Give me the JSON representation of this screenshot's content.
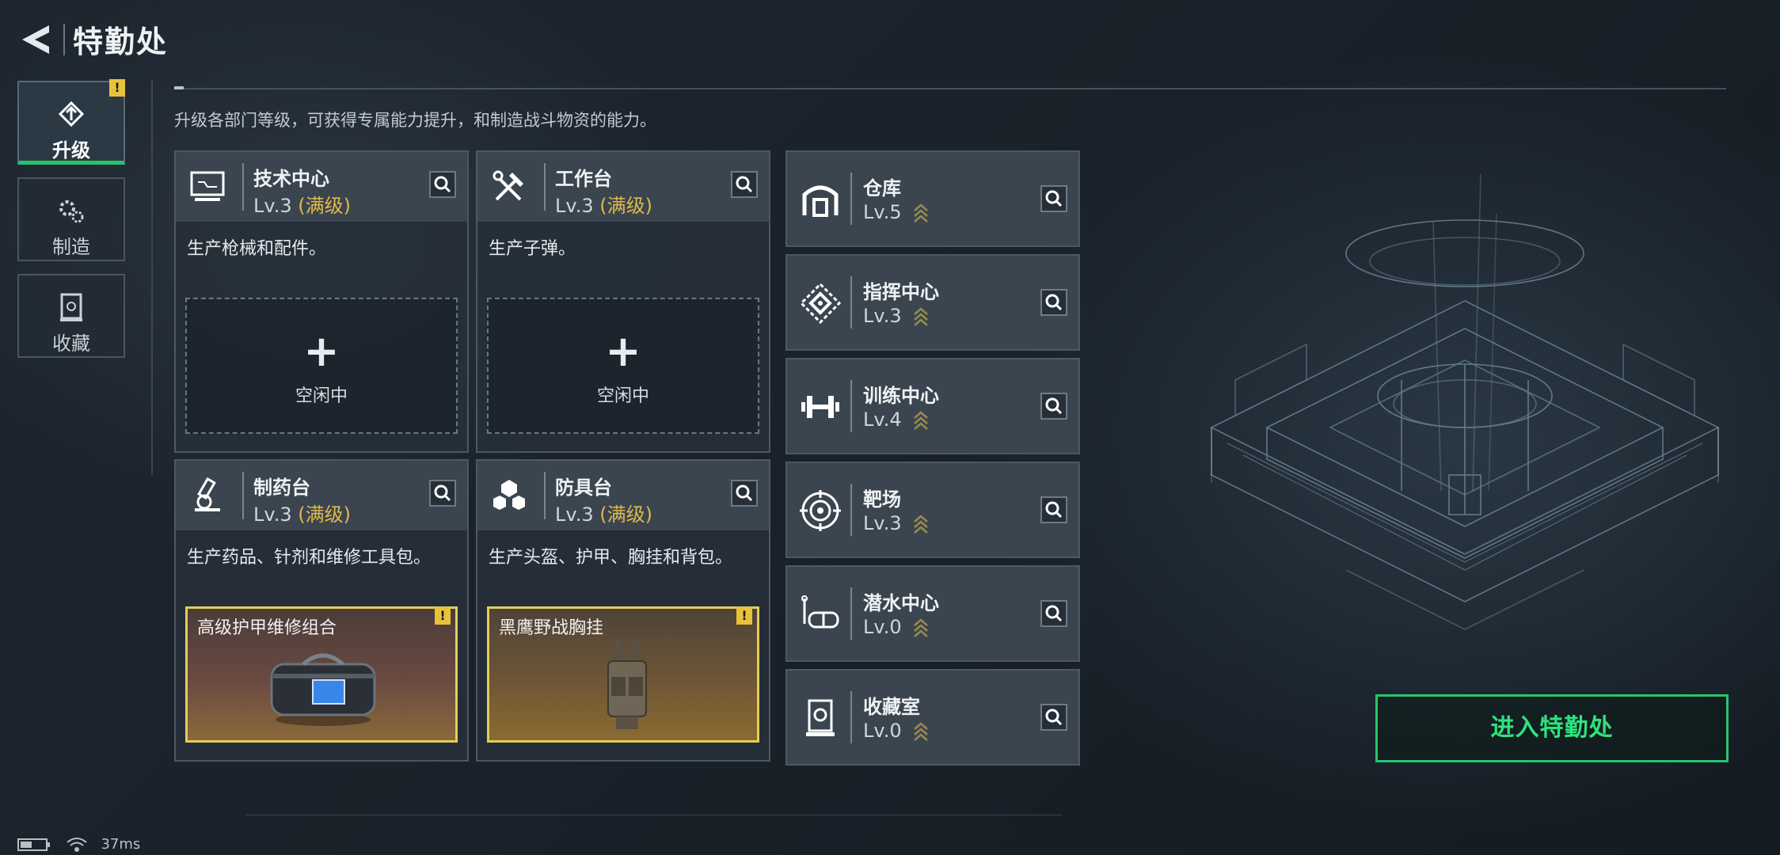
{
  "header": {
    "title": "特勤处"
  },
  "tabs": [
    {
      "label": "升级",
      "active": true,
      "badge": "!"
    },
    {
      "label": "制造",
      "active": false
    },
    {
      "label": "收藏",
      "active": false
    }
  ],
  "description": "升级各部门等级，可获得专属能力提升，和制造战斗物资的能力。",
  "cards": [
    {
      "name": "技术中心",
      "level": "Lv.3",
      "max_label": "(满级)",
      "desc": "生产枪械和配件。",
      "slot": {
        "plus": "+",
        "status": "空闲中"
      }
    },
    {
      "name": "工作台",
      "level": "Lv.3",
      "max_label": "(满级)",
      "desc": "生产子弹。",
      "slot": {
        "plus": "+",
        "status": "空闲中"
      }
    },
    {
      "name": "制药台",
      "level": "Lv.3",
      "max_label": "(满级)",
      "desc": "生产药品、针剂和维修工具包。",
      "item": {
        "name": "高级护甲维修组合",
        "badge": "!"
      }
    },
    {
      "name": "防具台",
      "level": "Lv.3",
      "max_label": "(满级)",
      "desc": "生产头盔、护甲、胸挂和背包。",
      "item": {
        "name": "黑鹰野战胸挂",
        "badge": "!"
      }
    }
  ],
  "facilities": [
    {
      "name": "仓库",
      "level": "Lv.5",
      "icon": "storage-icon"
    },
    {
      "name": "指挥中心",
      "level": "Lv.3",
      "icon": "command-icon"
    },
    {
      "name": "训练中心",
      "level": "Lv.4",
      "icon": "dumbbell-icon"
    },
    {
      "name": "靶场",
      "level": "Lv.3",
      "icon": "target-icon"
    },
    {
      "name": "潜水中心",
      "level": "Lv.0",
      "icon": "diving-mask-icon"
    },
    {
      "name": "收藏室",
      "level": "Lv.0",
      "icon": "collection-icon"
    }
  ],
  "enter_button": "进入特勤处",
  "status": {
    "ping": "37ms"
  },
  "colors": {
    "accent_green": "#2bc36e",
    "gold": "#e1b94a",
    "badge_yellow": "#e8c23a"
  }
}
